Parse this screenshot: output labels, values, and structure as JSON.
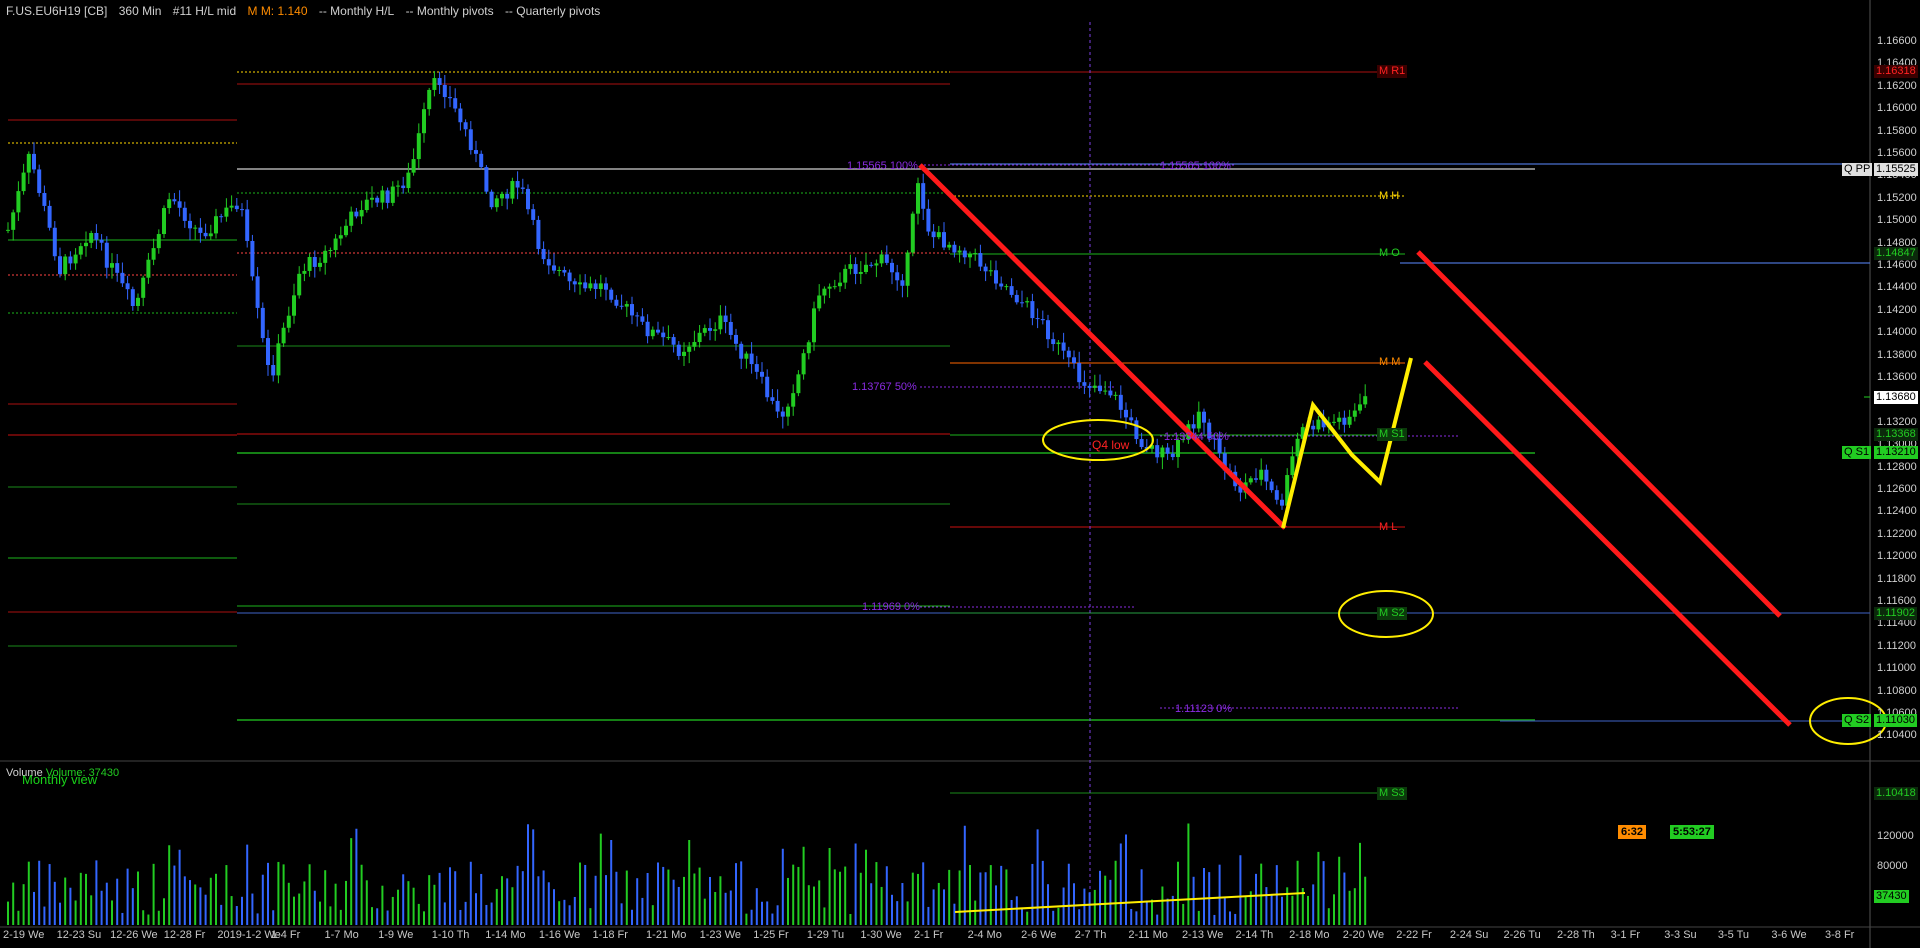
{
  "header": {
    "symbol": "F.US.EU6H19 [CB]",
    "interval": "360 Min",
    "study1": "#11 H/L mid",
    "study2": "M M: 1.140",
    "study3": "-- Monthly H/L",
    "study4": "-- Monthly pivots",
    "study5": "-- Quarterly pivots"
  },
  "colors": {
    "background": "#000000",
    "up_candle": "#22cc22",
    "down_candle": "#3366ff",
    "trend_red": "#ff1a1a",
    "yellow": "#ffee00",
    "purple": "#8a2be2",
    "orange": "#ff8c00"
  },
  "price_axis": {
    "ticks": [
      "1.16600",
      "1.16400",
      "1.16200",
      "1.16000",
      "1.15800",
      "1.15600",
      "1.15400",
      "1.15200",
      "1.15000",
      "1.14800",
      "1.14600",
      "1.14400",
      "1.14200",
      "1.14000",
      "1.13800",
      "1.13600",
      "1.13400",
      "1.13200",
      "1.13000",
      "1.12800",
      "1.12600",
      "1.12400",
      "1.12200",
      "1.12000",
      "1.11800",
      "1.11600",
      "1.11400",
      "1.11200",
      "1.11000",
      "1.10800",
      "1.10600",
      "1.10400"
    ],
    "current_price": "1.13680",
    "labels": {
      "m_r1_value": "1.16318",
      "q_pp_value": "1.15525",
      "m_o_value": "1.14847",
      "m_s1_value": "1.13368",
      "q_s1_value": "1.13210",
      "m_s2_value": "1.11902",
      "q_s2_value": "1.11030",
      "m_s3_value": "1.10418"
    }
  },
  "tags": {
    "m_r1": "M R1",
    "q_pp": "Q PP",
    "m_h": "M H",
    "m_o": "M O",
    "m_m": "M M",
    "m_s1": "M S1",
    "q_s1": "Q S1",
    "m_l": "M L",
    "m_s2": "M S2",
    "q_s2": "Q S2",
    "m_s3": "M S3"
  },
  "annotations": {
    "fib_100_a": "1.15565 100%",
    "fib_100_b": "1.15565 100%",
    "fib_50_a": "1.13767 50%",
    "fib_50_b": "1.13344 50%",
    "fib_0_a": "1.11969 0%",
    "fib_0_b": "1.11123 0%",
    "q4_low": "Q4 low",
    "monthly_view": "Monthly view"
  },
  "volume": {
    "label": "Volume",
    "value_label": "Volume: 37430",
    "ticks": [
      "120000",
      "80000",
      "40000"
    ],
    "current": "37430"
  },
  "timers": {
    "bar_timer": "6:32",
    "session_timer": "5:53:27"
  },
  "date_axis": [
    "2-19 We",
    "12-23 Su",
    "12-26 We",
    "12-28 Fr",
    "2019-1-2 We",
    "1-4 Fr",
    "1-7 Mo",
    "1-9 We",
    "1-10 Th",
    "1-14 Mo",
    "1-16 We",
    "1-18 Fr",
    "1-21 Mo",
    "1-23 We",
    "1-25 Fr",
    "1-29 Tu",
    "1-30 We",
    "2-1 Fr",
    "2-4 Mo",
    "2-6 We",
    "2-7 Th",
    "2-11 Mo",
    "2-13 We",
    "2-14 Th",
    "2-18 Mo",
    "2-20 We",
    "2-22 Fr",
    "2-24 Su",
    "2-26 Tu",
    "2-28 Th",
    "3-1 Fr",
    "3-3 Su",
    "3-5 Tu",
    "3-6 We",
    "3-8 Fr"
  ]
}
